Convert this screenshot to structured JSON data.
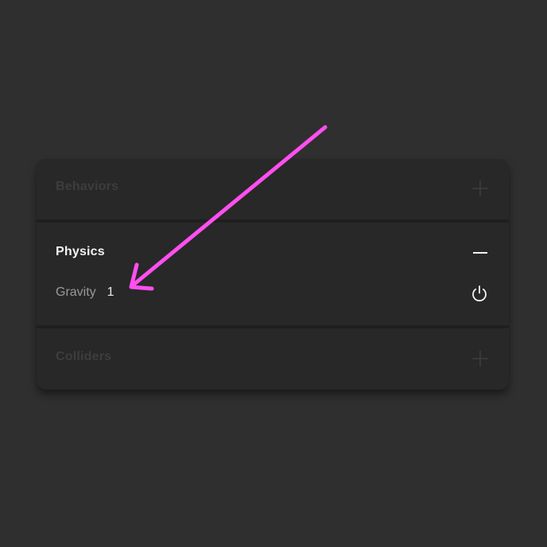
{
  "panel": {
    "sections": [
      {
        "id": "behaviors",
        "title": "Behaviors",
        "expanded": false,
        "action_icon": "plus-icon"
      },
      {
        "id": "physics",
        "title": "Physics",
        "expanded": true,
        "action_icon": "minus-icon",
        "properties": [
          {
            "label": "Gravity",
            "value": "1",
            "toggle_icon": "power-icon"
          }
        ]
      },
      {
        "id": "colliders",
        "title": "Colliders",
        "expanded": false,
        "action_icon": "plus-icon"
      }
    ]
  },
  "annotation": {
    "type": "arrow",
    "color": "#ff4ff0",
    "points_to": "gravity-value"
  },
  "colors": {
    "background": "#2f2f2f",
    "panel": "#282828",
    "divider": "#1f1f1f",
    "title_active": "#f2f2f2",
    "title_inactive": "#3d3d3d",
    "label": "#9a9a9a",
    "value": "#e8e8e8"
  }
}
